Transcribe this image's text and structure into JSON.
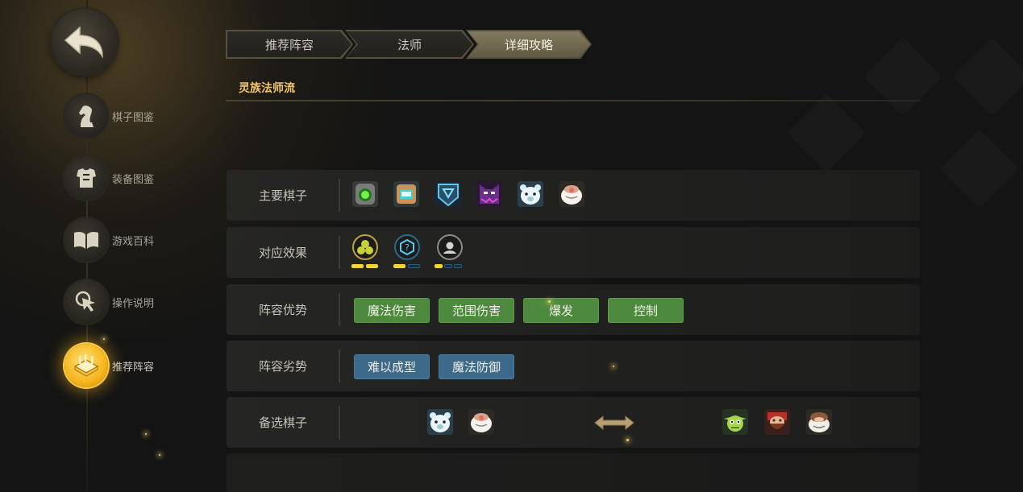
{
  "sidebar": {
    "back_label": "",
    "items": [
      {
        "label": "棋子图鉴",
        "icon": "knight-icon",
        "active": false
      },
      {
        "label": "装备图鉴",
        "icon": "armor-icon",
        "active": false
      },
      {
        "label": "游戏百科",
        "icon": "book-icon",
        "active": false
      },
      {
        "label": "操作说明",
        "icon": "cursor-click-icon",
        "active": false
      },
      {
        "label": "推荐阵容",
        "icon": "chessboard-icon",
        "active": true
      }
    ]
  },
  "breadcrumb": [
    "推荐阵容",
    "法师",
    "详细攻略"
  ],
  "breadcrumb_active_index": 2,
  "section_title": "灵族法师流",
  "rows": {
    "main_units": {
      "label": "主要棋子",
      "units": [
        "green-orb-robot-icon",
        "teal-box-creature-icon",
        "blue-shield-mage-icon",
        "purple-horned-demon-icon",
        "polar-bear-icon",
        "white-sheep-icon"
      ]
    },
    "synergies": {
      "label": "对应效果",
      "traits": [
        {
          "icon": "triple-circle-trait-icon",
          "pips_on": 2,
          "pips_total": 2
        },
        {
          "icon": "question-hex-trait-icon",
          "pips_on": 1,
          "pips_total": 2
        },
        {
          "icon": "person-circle-trait-icon",
          "pips_on": 1,
          "pips_total": 3
        }
      ]
    },
    "strengths": {
      "label": "阵容优势",
      "tags": [
        "魔法伤害",
        "范围伤害",
        "爆发",
        "控制"
      ]
    },
    "weaknesses": {
      "label": "阵容劣势",
      "tags": [
        "难以成型",
        "魔法防御"
      ]
    },
    "alternatives": {
      "label": "备选棋子",
      "from_units": [
        "polar-bear-icon",
        "white-sheep-icon"
      ],
      "to_units": [
        "green-goblin-icon",
        "red-bearded-dwarf-icon",
        "brown-sheep-icon"
      ]
    }
  },
  "colors": {
    "accent_gold": "#f0c66b",
    "tag_good": "#4e8a3e",
    "tag_bad": "#3d6a8a",
    "pip_on": "#f2d53a"
  }
}
